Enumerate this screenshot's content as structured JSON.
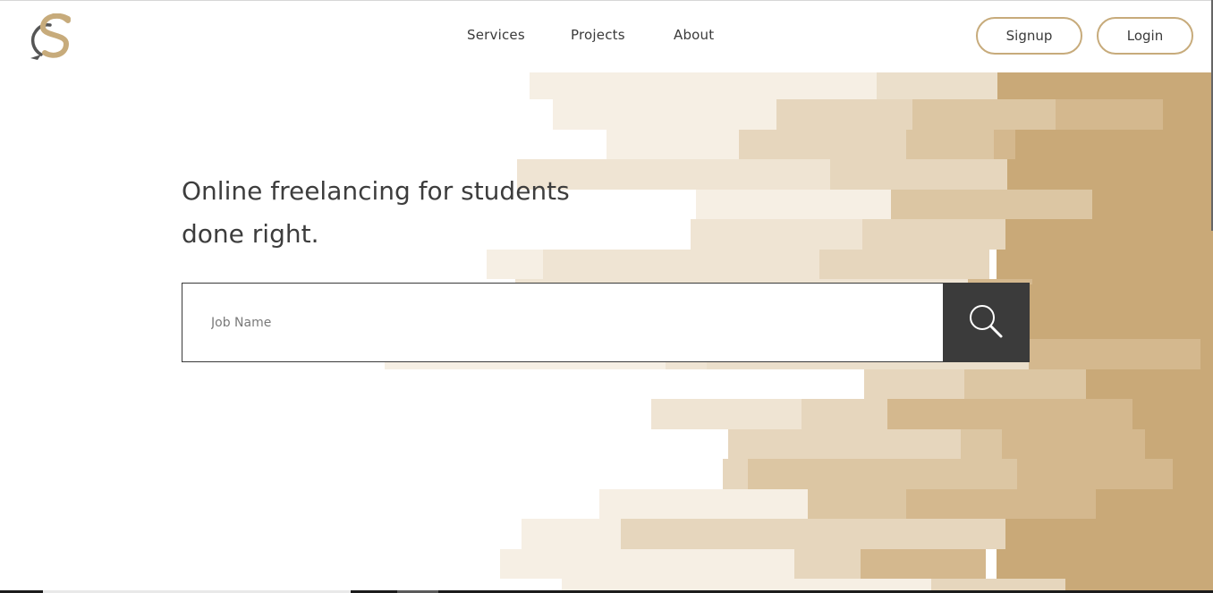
{
  "brand": {
    "logo_icon": "letter-s-logo-icon",
    "accent": "#c7ab7b",
    "dark": "#3b3b3b"
  },
  "nav": {
    "services": "Services",
    "projects": "Projects",
    "about": "About"
  },
  "auth": {
    "signup": "Signup",
    "login": "Login"
  },
  "hero": {
    "title_line1": "Online freelancing for students",
    "title_line2": "done right."
  },
  "search": {
    "placeholder": "Job Name",
    "icon": "search-icon"
  }
}
